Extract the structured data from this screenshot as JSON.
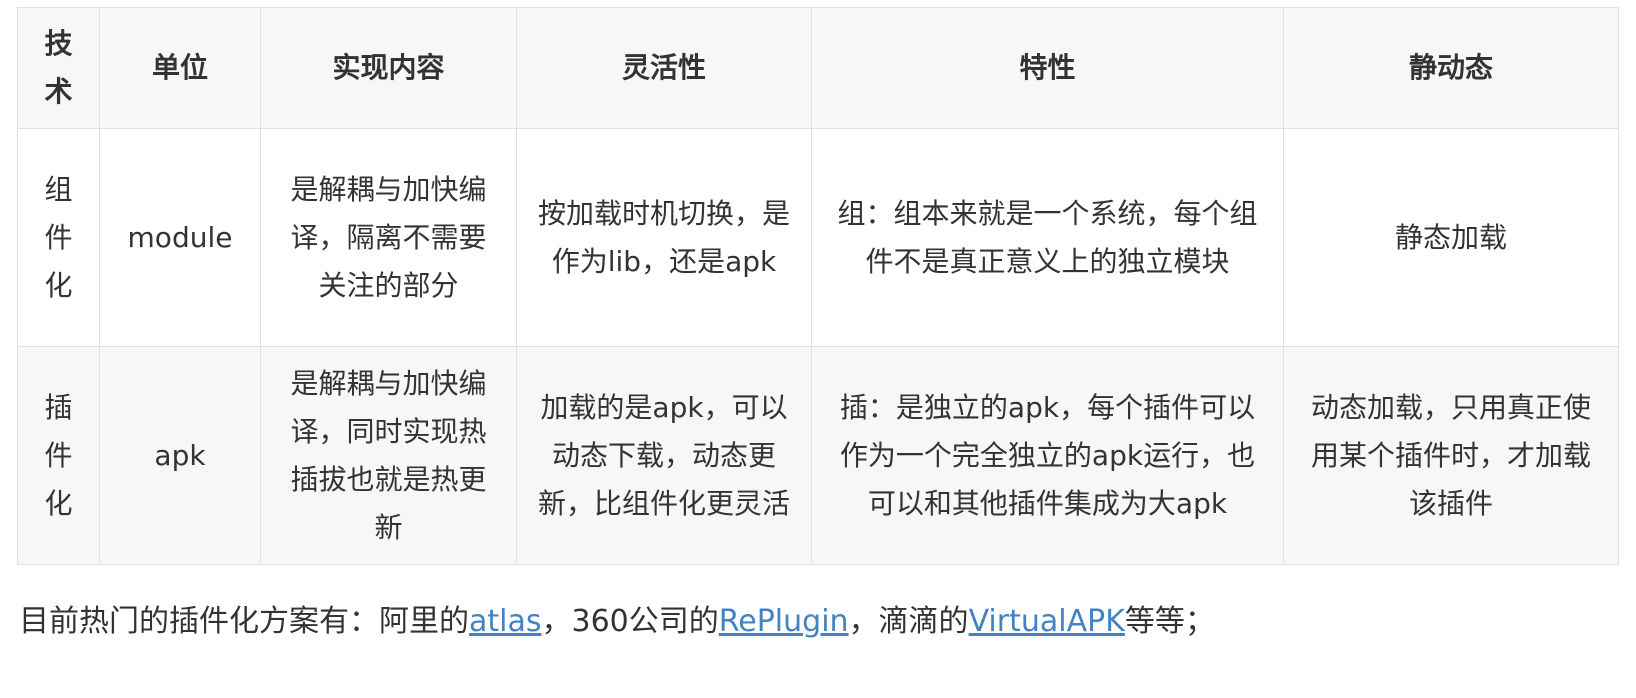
{
  "table": {
    "headers": [
      "技术",
      "单位",
      "实现内容",
      "灵活性",
      "特性",
      "静动态"
    ],
    "rows": [
      [
        "组件化",
        "module",
        "是解耦与加快编译，隔离不需要关注的部分",
        "按加载时机切换，是作为lib，还是apk",
        "组：组本来就是一个系统，每个组件不是真正意义上的独立模块",
        "静态加载"
      ],
      [
        "插件化",
        "apk",
        "是解耦与加快编译，同时实现热插拔也就是热更新",
        "加载的是apk，可以动态下载，动态更新，比组件化更灵活",
        "插：是独立的apk，每个插件可以作为一个完全独立的apk运行，也可以和其他插件集成为大apk",
        "动态加载，只用真正使用某个插件时，才加载该插件"
      ]
    ]
  },
  "paragraph": {
    "prefix": "目前热门的插件化方案有：阿里的",
    "link1": "atlas",
    "mid1": "，360公司的",
    "link2": "RePlugin",
    "mid2": "，滴滴的",
    "link3": "VirtualAPK",
    "suffix": "等等；"
  },
  "colors": {
    "border": "#dfe2e5",
    "header_bg": "#f7f7f7",
    "stripe_bg": "#f7f7f7",
    "text": "#333333",
    "link": "#4183c4"
  }
}
